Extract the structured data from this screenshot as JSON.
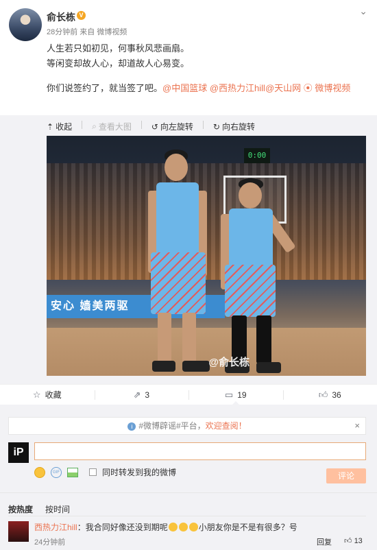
{
  "post": {
    "author": "俞长栋",
    "verified_badge": "V",
    "meta": "28分钟前 来自 微博视频",
    "menu_icon": "chevron-down-icon",
    "lines": [
      "人生若只如初见，何事秋风悲画扇。",
      "等闲变却故人心，却道故人心易变。"
    ],
    "last_line_prefix": "你们说签约了，就当签了吧。",
    "mentions": [
      "@中国篮球",
      "@西热力江hill",
      "@天山网"
    ],
    "video_link": "微博视频"
  },
  "media_tools": {
    "collapse": "收起",
    "view_large": "查看大图",
    "rotate_left": "向左旋转",
    "rotate_right": "向右旋转"
  },
  "photo": {
    "watermark": "@俞长栋",
    "banner_text": "安心 嫱美两驱",
    "scoreboard": "0:00"
  },
  "actions": {
    "favorite": "收藏",
    "repost_count": "3",
    "comment_count": "19",
    "like_count": "36"
  },
  "composer": {
    "notice": "#微博辟谣#平台，欢迎查阅！",
    "notice_prefix": "#微博辟谣#平台，",
    "notice_highlight": "欢迎查阅！",
    "notice_close": "×",
    "avatar_text": "iP",
    "placeholder": "",
    "also_repost": "同时转发到我的微博",
    "submit": "评论"
  },
  "sort": {
    "by_hot": "按热度",
    "by_time": "按时间"
  },
  "comments": [
    {
      "user": "西热力江hill",
      "text_before": "：我合同好像还没到期呢",
      "text_after": "小朋友你是不是有很多？号",
      "time": "24分钟前",
      "reply": "回复",
      "likes": "13"
    }
  ],
  "colors": {
    "link": "#eb7350",
    "accent": "#ff8140",
    "background": "#f2f2f5"
  }
}
